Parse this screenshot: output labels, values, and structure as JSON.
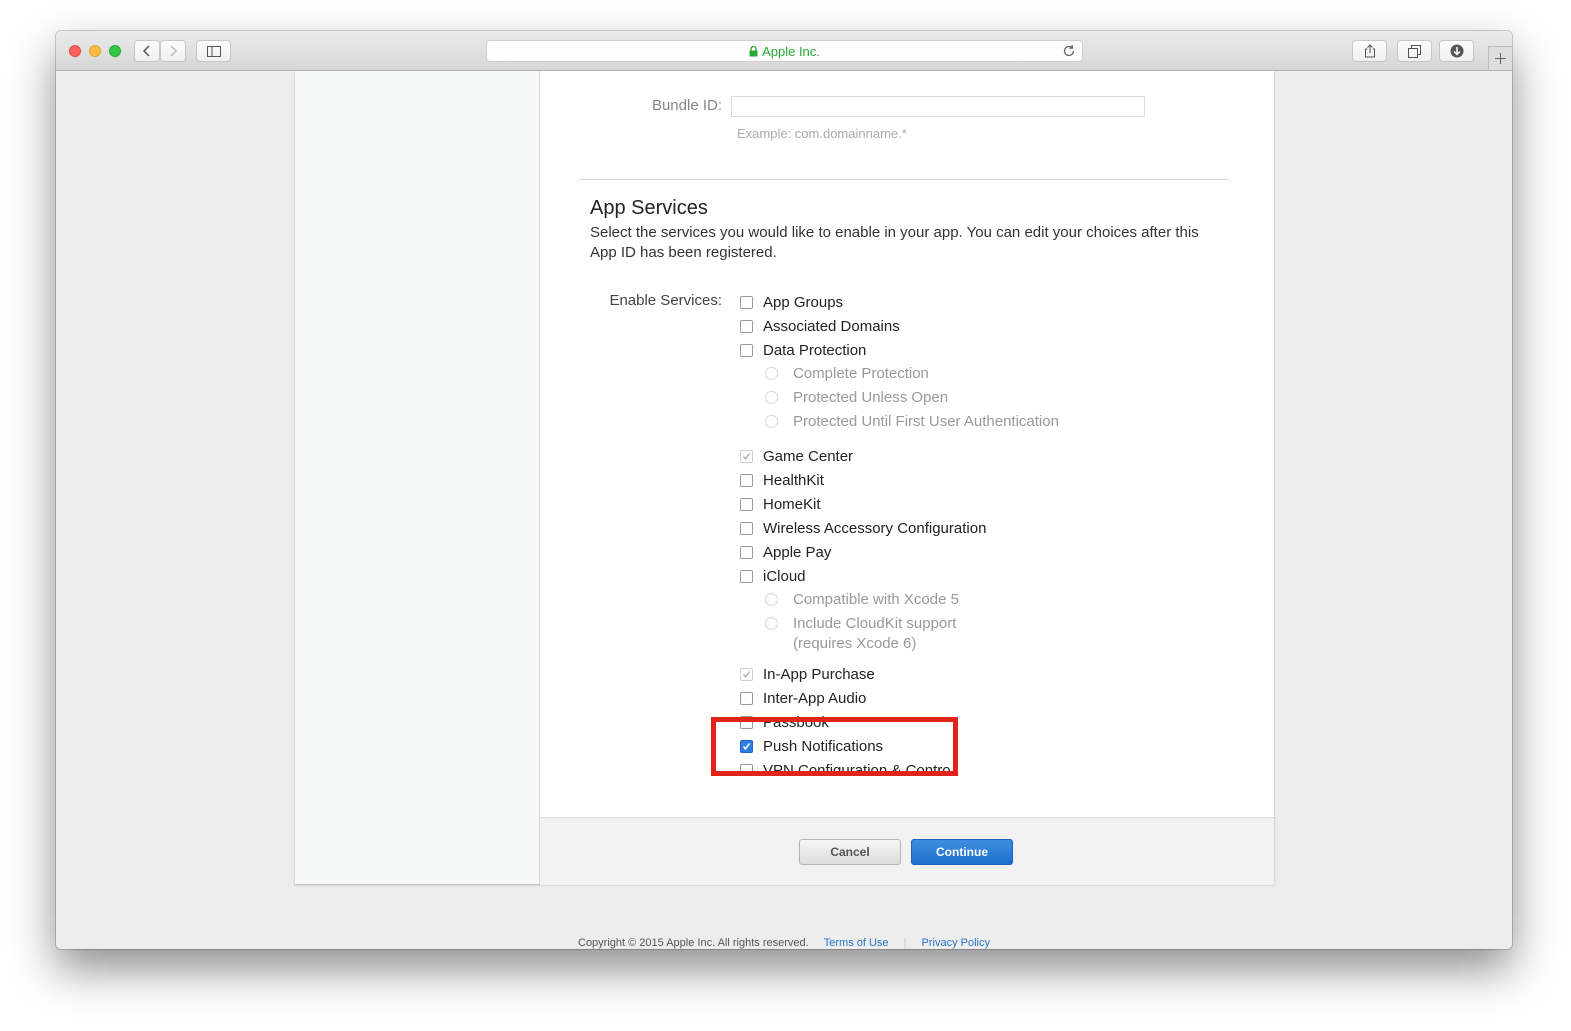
{
  "browser": {
    "address_text": "Apple Inc.",
    "icons": {
      "back": "chevron-left-icon",
      "forward": "chevron-right-icon",
      "sidebar": "sidebar-icon",
      "lock": "lock-icon",
      "reload": "reload-icon",
      "share": "share-icon",
      "tabs": "tabs-icon",
      "downloads": "downloads-icon",
      "new_tab": "plus-icon"
    },
    "colors": {
      "secure_green": "#28a935"
    }
  },
  "form": {
    "bundle_id_label": "Bundle ID:",
    "bundle_id_value": "",
    "bundle_id_hint": "Example: com.domainname.*"
  },
  "app_services": {
    "title": "App Services",
    "description": "Select the services you would like to enable in your app. You can edit your choices after this App ID has been registered.",
    "enable_label": "Enable Services:",
    "services": {
      "app_groups": {
        "label": "App Groups",
        "checked": false
      },
      "associated_domains": {
        "label": "Associated Domains",
        "checked": false
      },
      "data_protection": {
        "label": "Data Protection",
        "checked": false,
        "options": [
          "Complete Protection",
          "Protected Unless Open",
          "Protected Until First User Authentication"
        ]
      },
      "game_center": {
        "label": "Game Center",
        "checked": true,
        "disabled": true
      },
      "healthkit": {
        "label": "HealthKit",
        "checked": false
      },
      "homekit": {
        "label": "HomeKit",
        "checked": false
      },
      "wireless_accessory": {
        "label": "Wireless Accessory Configuration",
        "checked": false
      },
      "apple_pay": {
        "label": "Apple Pay",
        "checked": false
      },
      "icloud": {
        "label": "iCloud",
        "checked": false,
        "options": [
          "Compatible with Xcode 5",
          "Include CloudKit support",
          "(requires Xcode 6)"
        ]
      },
      "in_app_purchase": {
        "label": "In-App Purchase",
        "checked": true,
        "disabled": true
      },
      "inter_app_audio": {
        "label": "Inter-App Audio",
        "checked": false
      },
      "passbook": {
        "label": "Passbook",
        "checked": false
      },
      "push_notifications": {
        "label": "Push Notifications",
        "checked": true
      },
      "vpn": {
        "label": "VPN Configuration & Contro",
        "checked": false
      }
    },
    "highlight_color": "#e2231a"
  },
  "actions": {
    "cancel": "Cancel",
    "continue": "Continue",
    "continue_color": "#2672d4"
  },
  "footer": {
    "copyright": "Copyright © 2015 Apple Inc. All rights reserved.",
    "terms": "Terms of Use",
    "separator": "|",
    "privacy": "Privacy Policy"
  }
}
